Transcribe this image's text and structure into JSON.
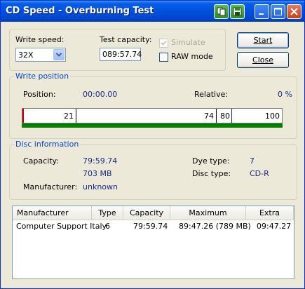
{
  "window": {
    "title": "CD Speed - Overburning Test",
    "title_buttons": [
      "copy-icon",
      "save-icon",
      "minimize-icon",
      "maximize-icon",
      "close-icon"
    ]
  },
  "settings": {
    "write_speed_label": "Write speed:",
    "write_speed_value": "32X",
    "test_capacity_label": "Test capacity:",
    "test_capacity_value": "089:57.74",
    "simulate_label": "Simulate",
    "simulate_checked": true,
    "simulate_enabled": false,
    "raw_mode_label": "RAW mode",
    "raw_mode_checked": false
  },
  "buttons": {
    "start": "Start",
    "close": "Close"
  },
  "write_position": {
    "group_title": "Write position",
    "position_label": "Position:",
    "position_value": "00:00.00",
    "relative_label": "Relative:",
    "relative_value": "0 %",
    "markers": [
      "21",
      "74",
      "80",
      "100"
    ]
  },
  "disc_info": {
    "group_title": "Disc information",
    "capacity_label": "Capacity:",
    "capacity_time": "79:59.74",
    "capacity_size": "703 MB",
    "dye_type_label": "Dye type:",
    "dye_type_value": "7",
    "disc_type_label": "Disc type:",
    "disc_type_value": "CD-R",
    "manufacturer_label": "Manufacturer:",
    "manufacturer_value": "unknown"
  },
  "table": {
    "columns": [
      "Manufacturer",
      "Type",
      "Capacity",
      "Maximum",
      "Extra"
    ],
    "rows": [
      [
        "Computer Support Italy",
        "6",
        "79:59.74",
        "89:47.26 (789 MB)",
        "09:47.27"
      ]
    ]
  },
  "colors": {
    "title_bar": "#0054e3",
    "group_title": "#0046d5",
    "value_text": "#1a2a8c",
    "progress_bar": "#008000",
    "window_bg": "#ece9d8"
  }
}
